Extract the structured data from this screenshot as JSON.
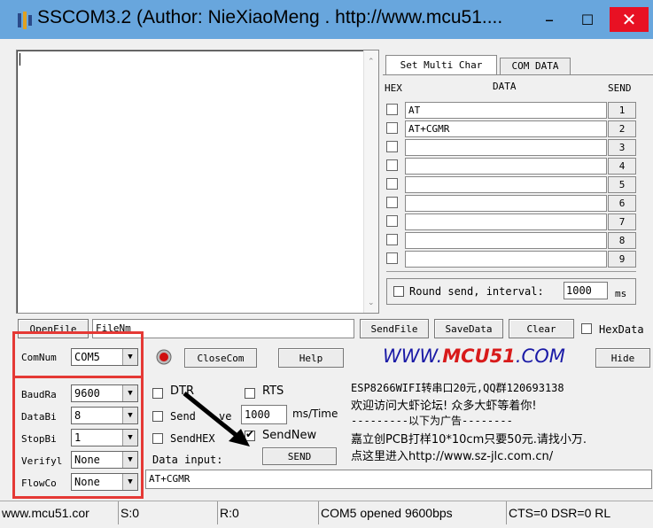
{
  "window": {
    "title": "SSCOM3.2 (Author: NieXiaoMeng . http://www.mcu51....",
    "min_glyph": "–",
    "max_glyph": "☐",
    "close_glyph": "✕"
  },
  "multi_panel": {
    "tabs": [
      "Set Multi Char",
      "COM DATA"
    ],
    "headers": {
      "hex": "HEX",
      "data": "DATA",
      "send": "SEND"
    },
    "rows": [
      {
        "data": "AT",
        "send": "1"
      },
      {
        "data": "AT+CGMR",
        "send": "2"
      },
      {
        "data": "",
        "send": "3"
      },
      {
        "data": "",
        "send": "4"
      },
      {
        "data": "",
        "send": "5"
      },
      {
        "data": "",
        "send": "6"
      },
      {
        "data": "",
        "send": "7"
      },
      {
        "data": "",
        "send": "8"
      },
      {
        "data": "",
        "send": "9"
      }
    ],
    "round_send_label": "Round send, interval:",
    "interval_value": "1000",
    "interval_unit": "ms"
  },
  "file_bar": {
    "open_file": "OpenFile",
    "file_name": "FileNm",
    "send_file": "SendFile",
    "save_data": "SaveData",
    "clear": "Clear",
    "hex_data": "HexData"
  },
  "port_bar": {
    "com_num_label": "ComNum",
    "com_num_value": "COM5",
    "close_com": "CloseCom",
    "help": "Help",
    "brand_prefix": "WWW.",
    "brand_mid": "MCU51",
    "brand_suffix": ".COM",
    "hide": "Hide"
  },
  "settings": {
    "baud_label": "BaudRa",
    "baud_value": "9600",
    "databits_label": "DataBi",
    "databits_value": "8",
    "stopbits_label": "StopBi",
    "stopbits_value": "1",
    "verify_label": "Verifyl",
    "verify_value": "None",
    "flow_label": "FlowCo",
    "flow_value": "None"
  },
  "options": {
    "dtr": "DTR",
    "rts": "RTS",
    "send_every_prefix": "Send",
    "send_every_suffix": "ve",
    "send_every_value": "1000",
    "send_every_unit": "ms/Time",
    "send_hex": "SendHEX",
    "send_new": "SendNew",
    "data_input_label": "Data input:",
    "send_button": "SEND",
    "data_input_value": "AT+CGMR"
  },
  "ad": {
    "line1": "ESP8266WIFI转串口20元,QQ群120693138",
    "line2": "欢迎访问大虾论坛! 众多大虾等着你!",
    "line3": "---------以下为广告--------",
    "line4": "嘉立创PCB打样10*10cm只要50元.请找小万.",
    "line5": "点这里进入http://www.sz-jlc.com.cn/"
  },
  "status": {
    "url": "www.mcu51.cor",
    "sent": "S:0",
    "received": "R:0",
    "port_state": "COM5 opened 9600bps",
    "sep": "1",
    "signals": "CTS=0 DSR=0 RL"
  },
  "colors": {
    "titlebar": "#68a6dd",
    "highlight_box": "#e53935",
    "brand_blue": "#1a1aa6",
    "brand_red": "#d81b1b"
  }
}
